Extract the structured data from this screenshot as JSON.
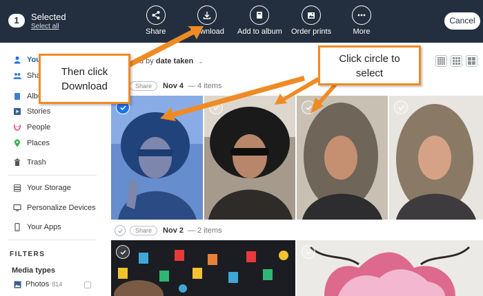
{
  "selection": {
    "count": "1",
    "label": "Selected",
    "select_all": "Select all"
  },
  "actions": {
    "share": "Share",
    "download": "Download",
    "add_to_album": "Add to album",
    "order_prints": "Order prints",
    "more": "More",
    "cancel": "Cancel"
  },
  "sidebar": {
    "items": [
      {
        "label": "Your",
        "icon": "person-icon"
      },
      {
        "label": "Sha",
        "icon": "people-icon"
      },
      {
        "label": "Albu",
        "icon": "album-icon"
      },
      {
        "label": "Stories",
        "icon": "play-icon"
      },
      {
        "label": "People",
        "icon": "face-icon"
      },
      {
        "label": "Places",
        "icon": "pin-icon"
      },
      {
        "label": "Trash",
        "icon": "trash-icon"
      },
      {
        "label": "Your Storage",
        "icon": "storage-icon"
      },
      {
        "label": "Personalize Devices",
        "icon": "monitor-icon"
      },
      {
        "label": "Your Apps",
        "icon": "phone-icon"
      }
    ],
    "filters_title": "FILTERS",
    "media_types_title": "Media types",
    "photos_label": "Photos",
    "photos_count": "814"
  },
  "main": {
    "sort_prefix": "d by",
    "sort_value": "date taken",
    "groups": [
      {
        "share": "Share",
        "date": "Nov 4",
        "count": "— 4 items"
      },
      {
        "share": "Share",
        "date": "Nov 2",
        "count": "— 2 items"
      }
    ]
  },
  "annotations": {
    "download_callout": "Then click Download",
    "circle_callout": "Click circle to select"
  },
  "colors": {
    "topbar": "#232f3e",
    "accent": "#f08a24",
    "select_blue": "#1a73e8"
  }
}
